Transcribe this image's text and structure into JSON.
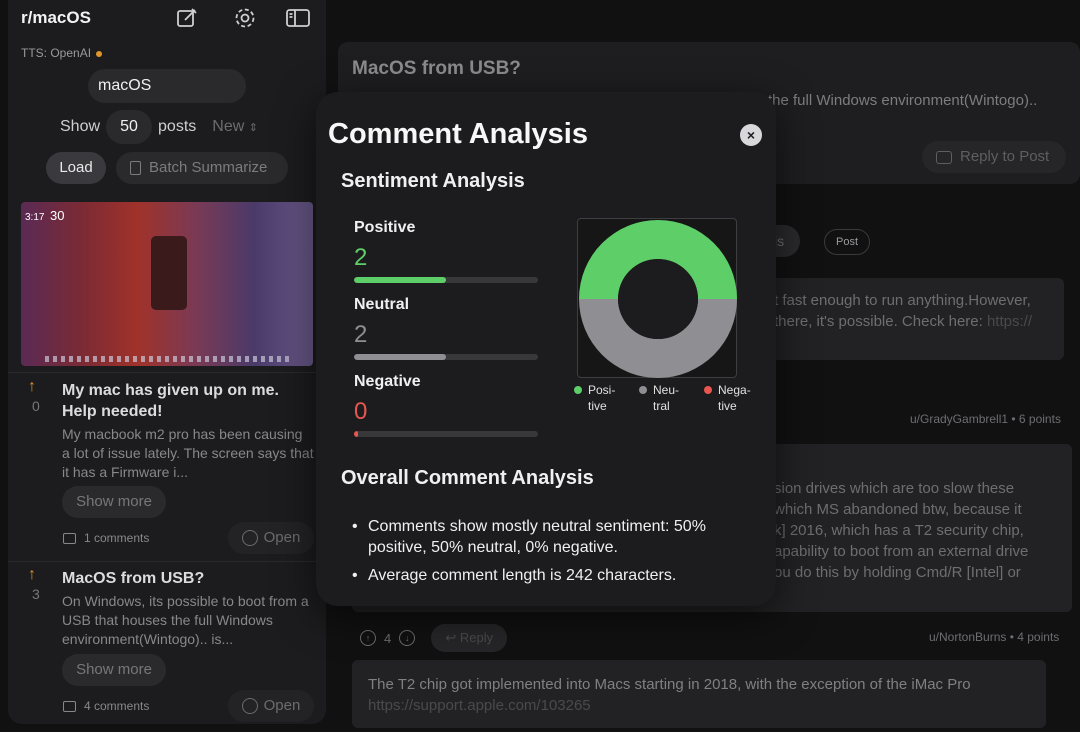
{
  "sidebar": {
    "title": "r/macOS",
    "tts_label": "TTS: OpenAI",
    "subreddit_value": "macOS",
    "show_label": "Show",
    "count_value": "50",
    "posts_label": "posts",
    "sort_value": "New",
    "load_label": "Load",
    "batch_label": "Batch Summarize",
    "thumb_time": "3:17",
    "thumb_date": "30",
    "posts": [
      {
        "score": "0",
        "title": "My mac has given up on me. Help needed!",
        "body": "My macbook m2 pro has been causing a lot of issue lately. The screen says that it has a Firmware i...",
        "show_more": "Show more",
        "comments": "1 comments",
        "open": "Open"
      },
      {
        "score": "3",
        "title": "MacOS from USB?",
        "body": "On Windows, its possible to boot from a USB that houses the full Windows environment(Wintogo).. is...",
        "show_more": "Show more",
        "comments": "4 comments",
        "open": "Open"
      }
    ]
  },
  "main": {
    "title": "MacOS from USB?",
    "text_fragment": "the full Windows environment(Wintogo)..",
    "reply_post_label": "Reply to Post",
    "pill_a": "is",
    "pill_b": "Post",
    "comment1": {
      "line1": "t fast enough to run anything.However,",
      "line2": "there, it's possible. Check here: ",
      "link": "https://"
    },
    "author1": "u/GradyGambrell1 • 6 points",
    "comment2": {
      "line1": "sion drives which are too slow these",
      "line2": "which MS abandoned btw, because it",
      "line3": "k] 2016, which has a T2 security chip,",
      "line4": "apability to boot from an external drive",
      "line5": "ou do this by holding Cmd/R [Intel] or"
    },
    "vote_count": "4",
    "reply_label": "Reply",
    "author2": "u/NortonBurns • 4 points",
    "comment3": {
      "text": "The T2 chip got implemented into Macs starting in 2018, with the exception of the iMac Pro",
      "link": " https://support.apple.com/103265"
    }
  },
  "modal": {
    "title": "Comment Analysis",
    "close": "×",
    "sentiment_title": "Sentiment Analysis",
    "positive_label": "Positive",
    "positive_value": "2",
    "neutral_label": "Neutral",
    "neutral_value": "2",
    "negative_label": "Negative",
    "negative_value": "0",
    "overall_title": "Overall Comment Analysis",
    "overall_points": [
      "Comments show mostly neutral sentiment: 50% positive, 50% neutral, 0% negative.",
      "Average comment length is 242 characters."
    ]
  },
  "colors": {
    "positive": "#5ecf68",
    "neutral": "#8e8e93",
    "negative": "#e8574f",
    "accent_orange": "#e0962b"
  },
  "chart_data": {
    "type": "pie",
    "categories": [
      "Posi-tive",
      "Neu-tral",
      "Nega-tive"
    ],
    "values": [
      2,
      2,
      0
    ],
    "legend_labels": [
      [
        "Posi-",
        "tive"
      ],
      [
        "Neu-",
        "tral"
      ],
      [
        "Nega-",
        "tive"
      ]
    ],
    "colors": [
      "#5ecf68",
      "#8e8e93",
      "#e8574f"
    ],
    "legend": "bottom"
  }
}
